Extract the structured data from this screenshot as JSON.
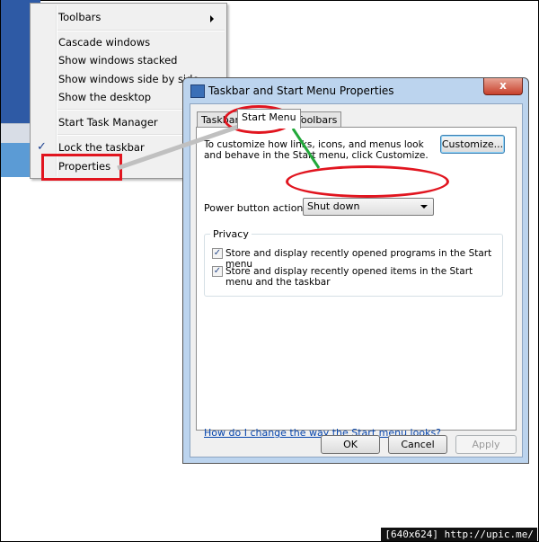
{
  "context_menu": {
    "items": [
      {
        "label": "Toolbars"
      },
      {
        "label": "Cascade windows"
      },
      {
        "label": "Show windows stacked"
      },
      {
        "label": "Show windows side by side"
      },
      {
        "label": "Show the desktop"
      },
      {
        "label": "Start Task Manager"
      },
      {
        "label": "Lock the taskbar"
      },
      {
        "label": "Properties"
      }
    ],
    "lock_check": "✓"
  },
  "dialog": {
    "title": "Taskbar and Start Menu Properties",
    "close_label": "x",
    "tabs": [
      "Taskbar",
      "Start Menu",
      "Toolbars"
    ],
    "description": "To customize how links, icons, and menus look and behave in the Start menu, click Customize.",
    "customize_label": "Customize...",
    "power_button_label": "Power button action:",
    "power_button_value": "Shut down",
    "privacy_title": "Privacy",
    "privacy_options": [
      {
        "label": "Store and display recently opened programs in the Start menu",
        "checked": true
      },
      {
        "label": "Store and display recently opened items in the Start menu and the taskbar",
        "checked": true
      }
    ],
    "help_link": "How do I change the way the Start menu looks?",
    "ok_label": "OK",
    "cancel_label": "Cancel",
    "apply_label": "Apply"
  },
  "watermark": "[640x624] http://upic.me/",
  "colors": {
    "highlight_red": "#e1151f",
    "connector_grey": "#c0c0c0",
    "connector_green": "#22a83a",
    "dialog_frame": "#bcd4ee"
  }
}
